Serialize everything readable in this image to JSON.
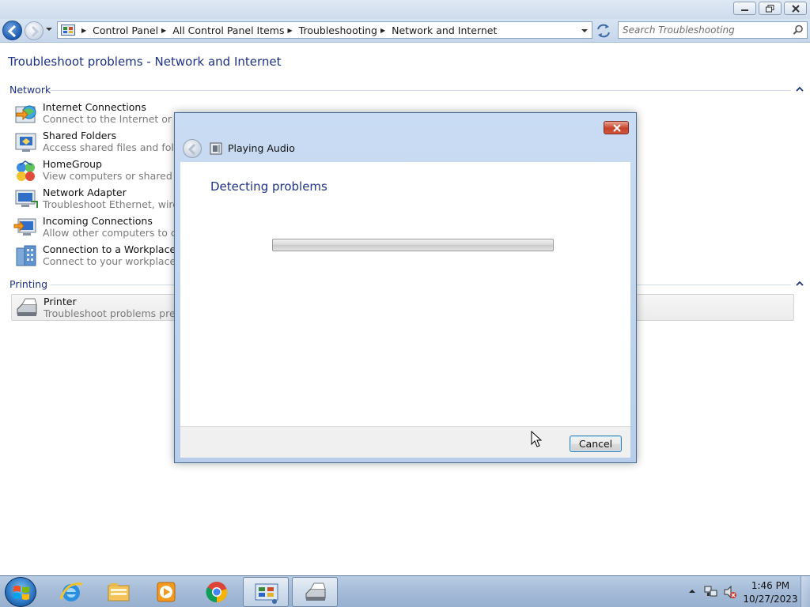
{
  "window": {
    "breadcrumb": [
      "Control Panel",
      "All Control Panel Items",
      "Troubleshooting",
      "Network and Internet"
    ],
    "search_placeholder": "Search Troubleshooting",
    "page_title": "Troubleshoot problems - Network and Internet"
  },
  "groups": [
    {
      "name": "Network",
      "items": [
        {
          "title": "Internet Connections",
          "desc": "Connect to the Internet or to a p",
          "icon": "internet-connections-icon"
        },
        {
          "title": "Shared Folders",
          "desc": "Access shared files and folders o",
          "icon": "shared-folders-icon"
        },
        {
          "title": "HomeGroup",
          "desc": "View computers or shared files i",
          "icon": "homegroup-icon"
        },
        {
          "title": "Network Adapter",
          "desc": "Troubleshoot Ethernet, wireless,",
          "icon": "network-adapter-icon"
        },
        {
          "title": "Incoming Connections",
          "desc": "Allow other computers to comm",
          "icon": "incoming-connections-icon"
        },
        {
          "title": "Connection to a Workplace Usin",
          "desc": "Connect to your workplace netw",
          "icon": "workplace-connection-icon"
        }
      ]
    },
    {
      "name": "Printing",
      "items": [
        {
          "title": "Printer",
          "desc": "Troubleshoot problems prevent",
          "icon": "printer-icon"
        }
      ]
    }
  ],
  "dialog": {
    "title": "Playing Audio",
    "heading": "Detecting problems",
    "progress_fraction": 0.0,
    "cancel_label": "Cancel"
  },
  "taskbar": {
    "items": [
      "start-orb",
      "internet-explorer-icon",
      "file-explorer-icon",
      "media-player-icon",
      "chrome-icon",
      "control-panel-icon",
      "printer-troubleshooter-icon"
    ],
    "clock_time": "1:46 PM",
    "clock_date": "10/27/2023"
  },
  "colors": {
    "heading_blue": "#1e3287",
    "progress_green": "#3bac36"
  }
}
